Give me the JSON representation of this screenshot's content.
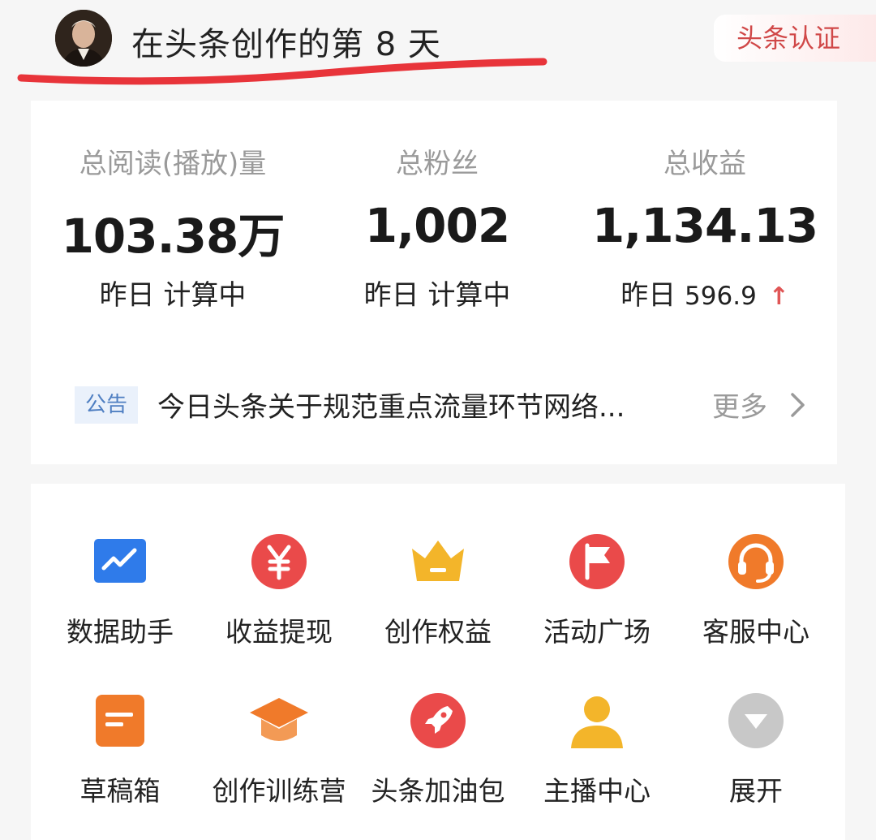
{
  "header": {
    "title": "在头条创作的第 8 天",
    "cert_link": "头条认证"
  },
  "stats": [
    {
      "label": "总阅读(播放)量",
      "value": "103.38万",
      "sub": "昨日 计算中"
    },
    {
      "label": "总粉丝",
      "value": "1,002",
      "sub": "昨日 计算中"
    },
    {
      "label": "总收益",
      "value": "1,134.13",
      "sub_label": "昨日",
      "sub_value": "596.9",
      "trend": "up"
    }
  ],
  "notice": {
    "tag": "公告",
    "text": "今日头条关于规范重点流量环节网络...",
    "more": "更多"
  },
  "tools": [
    {
      "label": "数据助手",
      "icon": "chart-icon",
      "color": "#2f7bea"
    },
    {
      "label": "收益提现",
      "icon": "yen-icon",
      "color": "#ea4a4a"
    },
    {
      "label": "创作权益",
      "icon": "crown-icon",
      "color": "#f3b52a"
    },
    {
      "label": "活动广场",
      "icon": "flag-icon",
      "color": "#ea4a4a"
    },
    {
      "label": "客服中心",
      "icon": "headset-icon",
      "color": "#f07a2a"
    },
    {
      "label": "草稿箱",
      "icon": "draft-icon",
      "color": "#f07a2a"
    },
    {
      "label": "创作训练营",
      "icon": "graduation-cap-icon",
      "color": "#f07a2a"
    },
    {
      "label": "头条加油包",
      "icon": "rocket-icon",
      "color": "#ea4a4a"
    },
    {
      "label": "主播中心",
      "icon": "user-icon",
      "color": "#f3b52a"
    },
    {
      "label": "展开",
      "icon": "expand-icon",
      "color": "#c8c8c8"
    }
  ],
  "accent_underline_color": "#e8343a"
}
